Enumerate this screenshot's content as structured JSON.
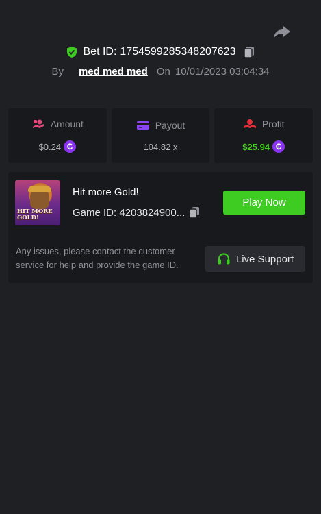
{
  "bet": {
    "label": "Bet ID:",
    "id": "1754599285348207623",
    "by_label": "By",
    "user": "med med med",
    "on_label": "On",
    "datetime": "10/01/2023 03:04:34"
  },
  "stats": {
    "amount": {
      "label": "Amount",
      "value": "$0.24",
      "icon": "amount-icon",
      "color": "#e4487a"
    },
    "payout": {
      "label": "Payout",
      "value": "104.82 x",
      "icon": "card-icon",
      "color": "#8a45f0"
    },
    "profit": {
      "label": "Profit",
      "value": "$25.94",
      "icon": "profit-icon",
      "color": "#e0303a"
    }
  },
  "currency_symbol": "₵",
  "game": {
    "title": "Hit more Gold!",
    "id_text": "Game ID: 4203824900...",
    "thumb_title": "HIT MORE GOLD!",
    "play_label": "Play Now"
  },
  "support": {
    "text": "Any issues, please contact the customer service for help and provide the game ID.",
    "button_label": "Live Support"
  },
  "colors": {
    "background": "#1f2024",
    "panel": "#18191c",
    "accent_green": "#3ecb22",
    "profit_green": "#45d21f",
    "coin_purple": "#8a33f0",
    "muted": "#8e8f98"
  }
}
